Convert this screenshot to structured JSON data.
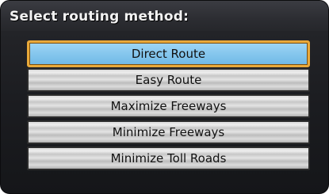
{
  "screen": {
    "title": "Select routing method:"
  },
  "menu": {
    "selected_index": 0,
    "options": [
      {
        "label": "Direct Route"
      },
      {
        "label": "Easy Route"
      },
      {
        "label": "Maximize Freeways"
      },
      {
        "label": "Minimize Freeways"
      },
      {
        "label": "Minimize Toll Roads"
      }
    ]
  },
  "colors": {
    "selection_border": "#e9a93a",
    "selection_fill": "#88c8ee",
    "background": "#1b1c20"
  }
}
